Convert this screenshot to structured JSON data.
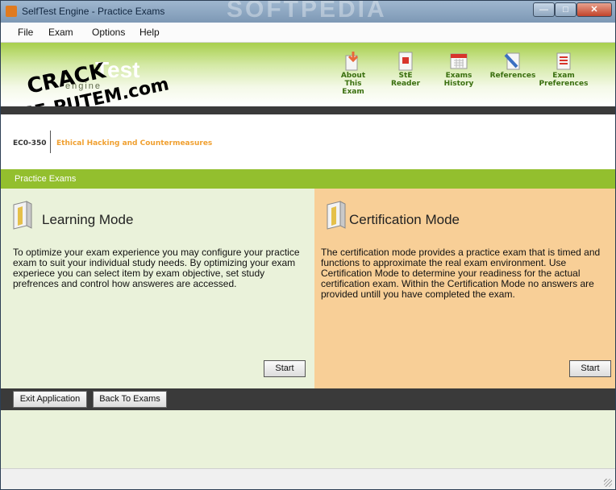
{
  "window": {
    "title": "SelfTest Engine - Practice Exams",
    "watermark": "SOFTPEDIA",
    "controls": {
      "minimize": "—",
      "maximize": "□",
      "close": "✕"
    }
  },
  "menu": [
    "File",
    "Exam",
    "Options",
    "Help"
  ],
  "header": {
    "logo_test": "Test",
    "logo_engine": "engine",
    "overlay_line1": "CRACK",
    "overlay_line2": "VSE-PUTEM.com",
    "tools": [
      {
        "label1": "About",
        "label2": "This Exam",
        "icon": "about-exam-icon"
      },
      {
        "label1": "StE Reader",
        "label2": "",
        "icon": "reader-icon"
      },
      {
        "label1": "Exams History",
        "label2": "",
        "icon": "calendar-icon"
      },
      {
        "label1": "References",
        "label2": "",
        "icon": "references-icon"
      },
      {
        "label1": "Exam",
        "label2": "Preferences",
        "icon": "preferences-icon"
      }
    ]
  },
  "exam": {
    "code": "EC0-350",
    "name": "Ethical Hacking and Countermeasures"
  },
  "section": {
    "title": "Practice Exams"
  },
  "learning": {
    "title": "Learning Mode",
    "text": "To optimize your exam experience you may configure your practice exam to suit your individual study needs. By optimizing your exam experiece you can select item by exam objective, set study prefrences and control how answeres are accessed.",
    "start_label": "Start"
  },
  "certification": {
    "title": "Certification Mode",
    "text": "The certification mode provides a practice exam that is timed and functions to approximate the real exam environment. Use Certification Mode to determine your readiness for the actual  certification exam. Within the Certification Mode no answers are provided untill you have completed the exam.",
    "start_label": "Start"
  },
  "bottom": {
    "exit_label": "Exit Application",
    "back_label": "Back To Exams"
  },
  "colors": {
    "accent_green": "#93bf2e",
    "dark_bar": "#3a3a3a",
    "left_panel": "#eaf2da",
    "right_panel": "#f8cf97",
    "exam_name": "#f0a030"
  }
}
